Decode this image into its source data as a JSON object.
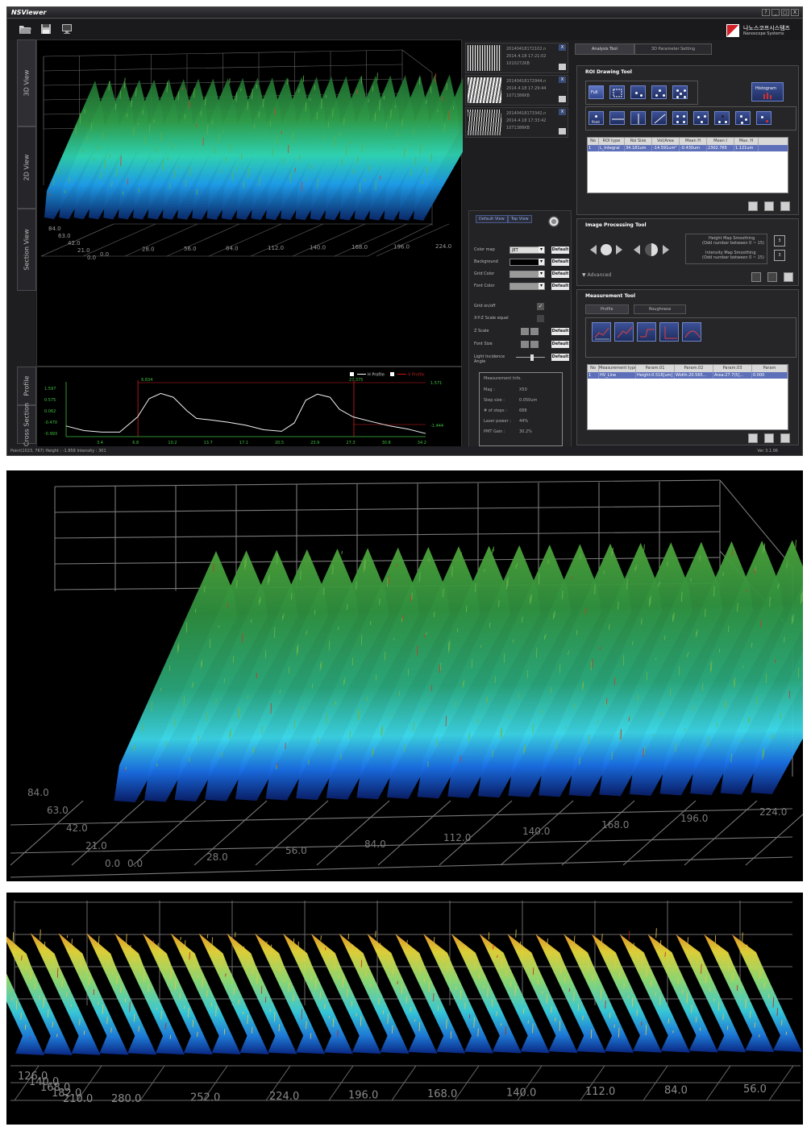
{
  "app": {
    "title": "NSViewer",
    "window_buttons": [
      "?",
      "_",
      "□",
      "X"
    ],
    "logo_ko": "나노스코프시스템즈",
    "logo_en": "Nanoscope Systems",
    "version": "Ver 3.1.06",
    "status": "Point(1023, 767) Height : -1.858 Intensity : 301"
  },
  "view_tabs": [
    "3D View",
    "2D View",
    "Section View",
    "Profile",
    "Cross Section"
  ],
  "view3d": {
    "x_ticks": [
      "0.0",
      "28.0",
      "56.0",
      "84.0",
      "112.0",
      "140.0",
      "168.0",
      "196.0",
      "224.0"
    ],
    "y_ticks": [
      "0.0",
      "21.0",
      "42.0",
      "63.0",
      "84.0"
    ]
  },
  "profile_chart": {
    "legend_h": "H Profile",
    "legend_v": "V Profile",
    "y_ticks": [
      "1.597",
      "0.575",
      "0.062",
      "-0.470",
      "-0.993"
    ],
    "x_ticks": [
      "3.4",
      "6.8",
      "10.2",
      "13.7",
      "17.1",
      "20.5",
      "23.9",
      "27.3",
      "30.8",
      "34.2"
    ],
    "markers": [
      "6.834",
      "27.375"
    ],
    "right_labels": [
      "1.571",
      "-1.444"
    ]
  },
  "chart_data": {
    "type": "line",
    "x": [
      0,
      1.7,
      3.4,
      5.1,
      6.8,
      7.9,
      9.0,
      10.2,
      11.5,
      12.4,
      13.7,
      15.4,
      17.1,
      18.8,
      20.5,
      21.7,
      22.8,
      23.9,
      25.1,
      26.0,
      27.3,
      29.0,
      30.8,
      32.5,
      34.2
    ],
    "y": [
      -0.8,
      -1.1,
      -1.2,
      -1.2,
      -0.2,
      1.0,
      1.35,
      1.1,
      0.2,
      -0.3,
      -0.4,
      -0.55,
      -0.75,
      -1.05,
      -1.15,
      -0.6,
      0.9,
      1.3,
      1.1,
      0.3,
      -0.2,
      -0.5,
      -0.8,
      -1.0,
      -1.3
    ],
    "xlim": [
      0,
      34.2
    ],
    "ylim": [
      -1.5,
      1.9
    ]
  },
  "thumbnails": [
    {
      "file": "20140418172102.n",
      "date": "2014.4.18 17:21:02",
      "size": "1010272KB"
    },
    {
      "file": "20140418172944.n",
      "date": "2014.4.18 17:29:44",
      "size": "1071386KB"
    },
    {
      "file": "20140418173342.n",
      "date": "2014.4.18 17:33:42",
      "size": "1071386KB"
    }
  ],
  "settings": {
    "tab_default": "Default View",
    "tab_top": "Top View",
    "color_map_label": "Color map",
    "color_map_value": "JET",
    "background_label": "Background",
    "grid_color_label": "Grid Color",
    "font_color_label": "Font Color",
    "default_label": "Default",
    "grid_onoff_label": "Grid on/off",
    "xyz_label": "X-Y-Z Scale equal",
    "zscale_label": "Z Scale",
    "font_size_label": "Font Size",
    "light_label": "Light Incidence Angle"
  },
  "measurement_info": {
    "title": "Measurement Info.",
    "rows": [
      {
        "k": "Mag :",
        "v": "X50"
      },
      {
        "k": "Step size :",
        "v": "0.050um"
      },
      {
        "k": "# of steps :",
        "v": "688"
      },
      {
        "k": "Laser power :",
        "v": "44%"
      },
      {
        "k": "PMT Gain :",
        "v": "30.2%"
      }
    ]
  },
  "right_tabs": [
    "Analysis Tool",
    "3D Parameter Setting"
  ],
  "roi": {
    "title": "ROI Drawing Tool",
    "full_label": "Full",
    "histogram_label": "Histogram",
    "point_label": "Point",
    "columns": [
      "No",
      "ROI type",
      "Roi Size",
      "Vol/Area",
      "Mean H",
      "Mean I",
      "Max. H"
    ],
    "rows": [
      [
        "1",
        "L_Integral",
        "34.181um",
        "-14.591um²",
        "-0.430um",
        "2302.765",
        "1.121um"
      ]
    ]
  },
  "image_processing": {
    "title": "Image Processing Tool",
    "height_smoothing": "Height Map Smoothing",
    "intensity_smoothing": "Intensity Map Smoothing",
    "odd_note": "(Odd number between 0 ~ 15)",
    "height_value": "3",
    "intensity_value": "3",
    "advanced": "Advanced"
  },
  "measurement_tool": {
    "title": "Measurement Tool",
    "tabs": [
      "Profile",
      "Roughness"
    ],
    "columns": [
      "No",
      "Measurement type",
      "Param.01",
      "Param.02",
      "Param.03",
      "Param"
    ],
    "rows": [
      [
        "1",
        "HV_Line",
        "Height:0.516[um]",
        "Width:20.565...",
        "Area:27.7(5]...",
        "0.000"
      ]
    ]
  },
  "photo2": {
    "x_ticks": [
      "0.0",
      "28.0",
      "56.0",
      "84.0",
      "112.0",
      "140.0",
      "168.0",
      "196.0",
      "224.0"
    ],
    "y_ticks": [
      "0.0",
      "21.0",
      "42.0",
      "63.0",
      "84.0"
    ]
  },
  "photo3": {
    "x_ticks": [
      "280.0",
      "252.0",
      "224.0",
      "196.0",
      "168.0",
      "140.0",
      "112.0",
      "84.0",
      "56.0"
    ],
    "y_ticks": [
      "126.0",
      "140.0",
      "168.0",
      "182.0",
      "210.0"
    ]
  }
}
